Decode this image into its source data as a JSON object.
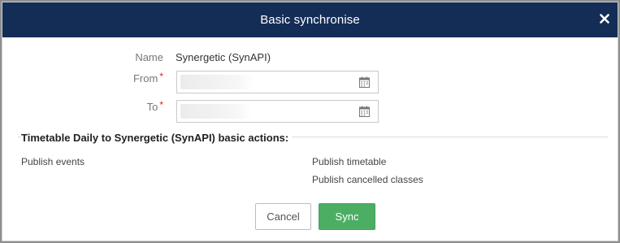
{
  "dialog": {
    "title": "Basic synchronise",
    "close_icon": "close-icon",
    "colors": {
      "header": "#142d57",
      "sync_button": "#4cae62",
      "required_marker": "#cc2b2b"
    }
  },
  "form": {
    "name": {
      "label": "Name",
      "value": "Synergetic (SynAPI)"
    },
    "from": {
      "label": "From",
      "required_marker": "*",
      "icon": "calendar-icon"
    },
    "to": {
      "label": "To",
      "required_marker": "*",
      "icon": "calendar-icon"
    }
  },
  "actions_section": {
    "title": "Timetable Daily to Synergetic (SynAPI) basic actions:",
    "left": [
      "Publish events"
    ],
    "right": [
      "Publish timetable",
      "Publish cancelled classes"
    ]
  },
  "buttons": {
    "cancel": "Cancel",
    "sync": "Sync"
  }
}
